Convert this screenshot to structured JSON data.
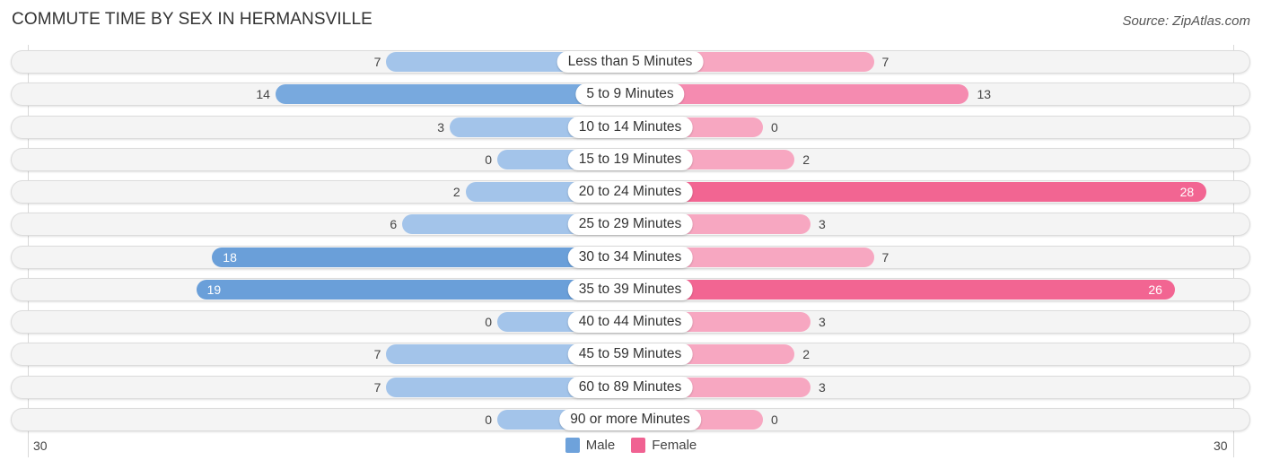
{
  "title": "COMMUTE TIME BY SEX IN HERMANSVILLE",
  "source": "Source: ZipAtlas.com",
  "colors": {
    "male": "#6ea2db",
    "female": "#f06292",
    "male_light": "#a8c8eb",
    "female_light": "#f7a8c2"
  },
  "chart_data": {
    "type": "bar",
    "orientation": "horizontal-diverging",
    "title": "COMMUTE TIME BY SEX IN HERMANSVILLE",
    "categories": [
      "Less than 5 Minutes",
      "5 to 9 Minutes",
      "10 to 14 Minutes",
      "15 to 19 Minutes",
      "20 to 24 Minutes",
      "25 to 29 Minutes",
      "30 to 34 Minutes",
      "35 to 39 Minutes",
      "40 to 44 Minutes",
      "45 to 59 Minutes",
      "60 to 89 Minutes",
      "90 or more Minutes"
    ],
    "series": [
      {
        "name": "Male",
        "values": [
          7,
          14,
          3,
          0,
          2,
          6,
          18,
          19,
          0,
          7,
          7,
          0
        ]
      },
      {
        "name": "Female",
        "values": [
          7,
          13,
          0,
          2,
          28,
          3,
          7,
          26,
          3,
          2,
          3,
          0
        ]
      }
    ],
    "axis": {
      "left_tick": "30",
      "right_tick": "30",
      "range": [
        0,
        30
      ]
    },
    "legend": {
      "position": "bottom-center",
      "entries": [
        "Male",
        "Female"
      ]
    }
  }
}
